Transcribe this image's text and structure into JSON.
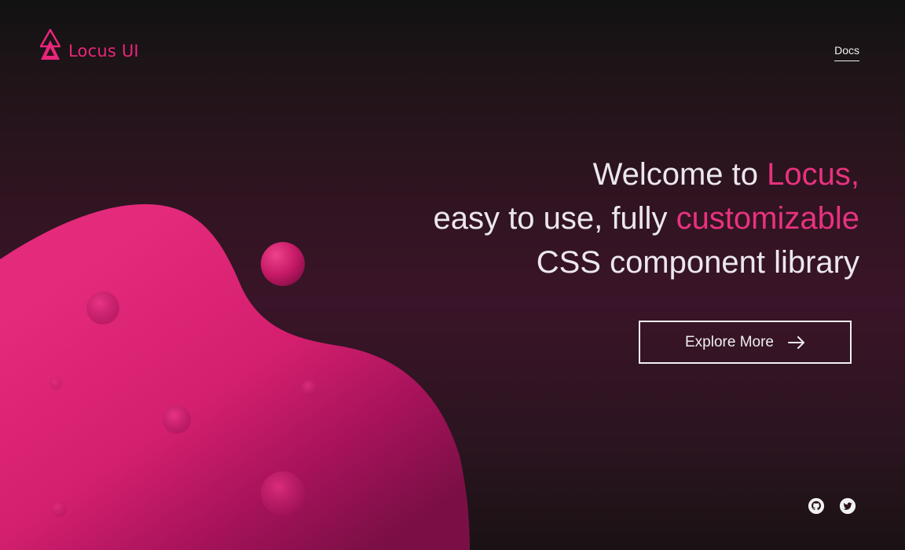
{
  "brand": {
    "name": "Locus UI",
    "color": "#e8267a"
  },
  "nav": {
    "docs_label": "Docs"
  },
  "hero": {
    "line1_prefix": "Welcome to ",
    "line1_accent": "Locus,",
    "line2_prefix": "easy to use, fully ",
    "line2_accent": "customizable",
    "line3": "CSS component library",
    "accent_color": "#e8327f"
  },
  "cta": {
    "label": "Explore More",
    "icon": "arrow-right-icon"
  },
  "social": [
    {
      "name": "github-icon"
    },
    {
      "name": "twitter-icon"
    }
  ],
  "colors": {
    "blob_light": "#e8287a",
    "blob_dark": "#9a1250",
    "background_dark": "#121212",
    "background_mid": "#3a1428"
  }
}
